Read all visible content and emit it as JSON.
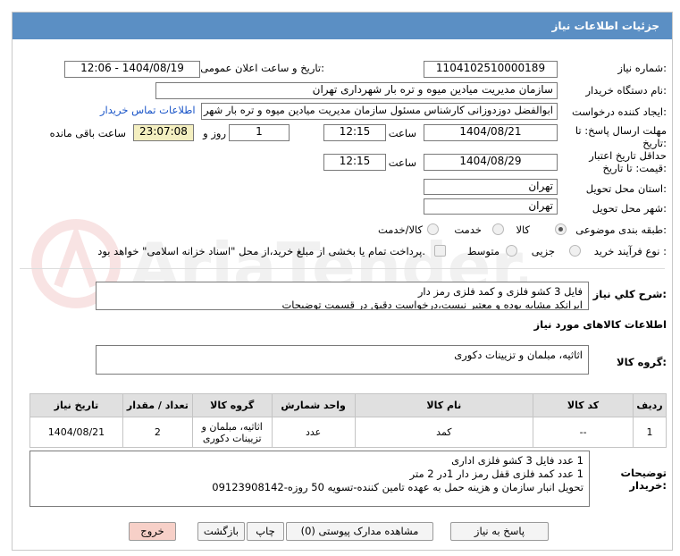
{
  "header": {
    "title": "جزئیات اطلاعات نیاز"
  },
  "form": {
    "need_number_label": "شماره نیاز:",
    "need_number": "1104102510000189",
    "announce_label": "تاریخ و ساعت اعلان عمومی:",
    "announce_value": "1404/08/19 - 12:06",
    "buyer_label": "نام دستگاه خریدار:",
    "buyer_value": "سازمان مدیریت میادین میوه و تره بار شهرداری تهران",
    "creator_label": "ایجاد کننده درخواست:",
    "creator_value": "ابوالفضل دوزدوزانی کارشناس مسئول سازمان مدیریت میادین میوه و تره بار شهر",
    "contact_link": "اطلاعات تماس خریدار",
    "deadline_label_1": "مهلت ارسال پاسخ: تا",
    "deadline_label_2": "تاریخ:",
    "deadline_date": "1404/08/21",
    "time_label": "ساعت",
    "deadline_time": "12:15",
    "days_value": "1",
    "days_label": "روز و",
    "remaining_value": "23:07:08",
    "remaining_label": "ساعت باقی مانده",
    "validity_label_1": "حداقل تاریخ اعتبار",
    "validity_label_2": "قیمت: تا تاریخ:",
    "validity_date": "1404/08/29",
    "validity_time": "12:15",
    "province_label": "استان محل تحویل:",
    "province_value": "تهران",
    "city_label": "شهر محل تحویل:",
    "city_value": "تهران",
    "category_label": "طبقه بندی موضوعی:",
    "category_options": [
      "کالا",
      "خدمت",
      "کالا/خدمت"
    ],
    "category_selected": "کالا",
    "process_label": "نوع فرآیند خرید :",
    "process_options": [
      "جزیی",
      "متوسط"
    ],
    "process_note": "پرداخت تمام یا بخشی از مبلغ خرید،از محل \"اسناد خزانه اسلامی\" خواهد بود."
  },
  "description": {
    "label": "شرح کلي نياز:",
    "line1": "فایل 3 کشو فلزی و کمد فلزی رمز دار",
    "line2": "ایرانکد مشابه بوده و معتبر نیست،درخواست دقیق در قسمت توضیحات"
  },
  "goods": {
    "section_title": "اطلاعات کالاهای مورد نیاز",
    "group_label": "گروه کالا:",
    "group_value": "اثاثیه، مبلمان و تزیینات دکوری"
  },
  "table": {
    "headers": [
      "ردیف",
      "کد کالا",
      "نام کالا",
      "واحد شمارش",
      "گروه کالا",
      "تعداد / مقدار",
      "تاریخ نیاز"
    ],
    "rows": [
      {
        "row": "1",
        "code": "--",
        "name": "کمد",
        "unit": "عدد",
        "group_1": "اثاثیه، مبلمان و",
        "group_2": "تزیینات دکوری",
        "qty": "2",
        "date": "1404/08/21"
      }
    ]
  },
  "buyer_notes": {
    "label_1": "توضیحات",
    "label_2": "خریدار:",
    "line1": "1 عدد فایل 3 کشو فلزی اداری",
    "line2": "1 عدد کمد فلزی قفل رمز دار 1در 2 متر",
    "line3": "تحویل انبار سازمان و هزینه حمل به عهده تامین کننده-تسویه 50 روزه-09123908142"
  },
  "buttons": {
    "reply": "پاسخ به نیاز",
    "attachments": "مشاهده مدارک پیوستی (0)",
    "print": "چاپ",
    "back": "بازگشت",
    "exit": "خروج"
  },
  "watermark": {
    "text": "AriaTender.net"
  }
}
